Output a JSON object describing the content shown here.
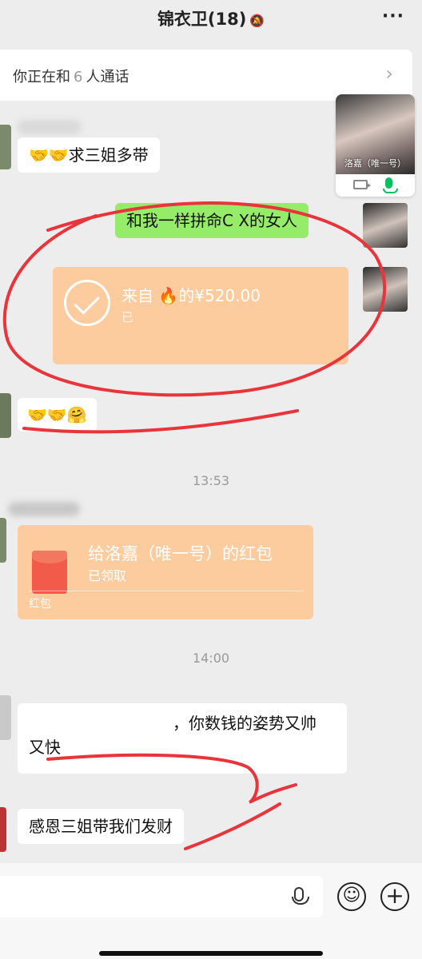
{
  "header": {
    "title": "锦衣卫(18)",
    "bell_icon": "mute-bell-icon",
    "more_label": "···"
  },
  "call": {
    "prefix": "你正在和",
    "count": "6",
    "suffix": "人通话",
    "arrow": "›"
  },
  "call_window": {
    "name": "洛嘉（唯一号）"
  },
  "messages": {
    "m1": "🤝🤝求三姐多带",
    "m2": "和我一样拼命C X的女人",
    "transfer_title": "来自 🔥的¥520.00",
    "transfer_status": "已",
    "m4": "🤝🤝🤗",
    "time1": "13:53",
    "packet_title": "给洛嘉（唯一号）的红包",
    "packet_status": "已领取",
    "packet_label": "红包",
    "time2": "14:00",
    "m5_line1": "，你数钱的姿势又帅",
    "m5_line2": "又快",
    "m6": "感恩三姐带我们发财"
  },
  "input": {
    "emoji": "☺",
    "plus": "+"
  },
  "colors": {
    "bubble_green": "#95ec69",
    "card_orange": "#fdcc9e",
    "annotation_red": "#e8343a",
    "wechat_green": "#07c160"
  }
}
